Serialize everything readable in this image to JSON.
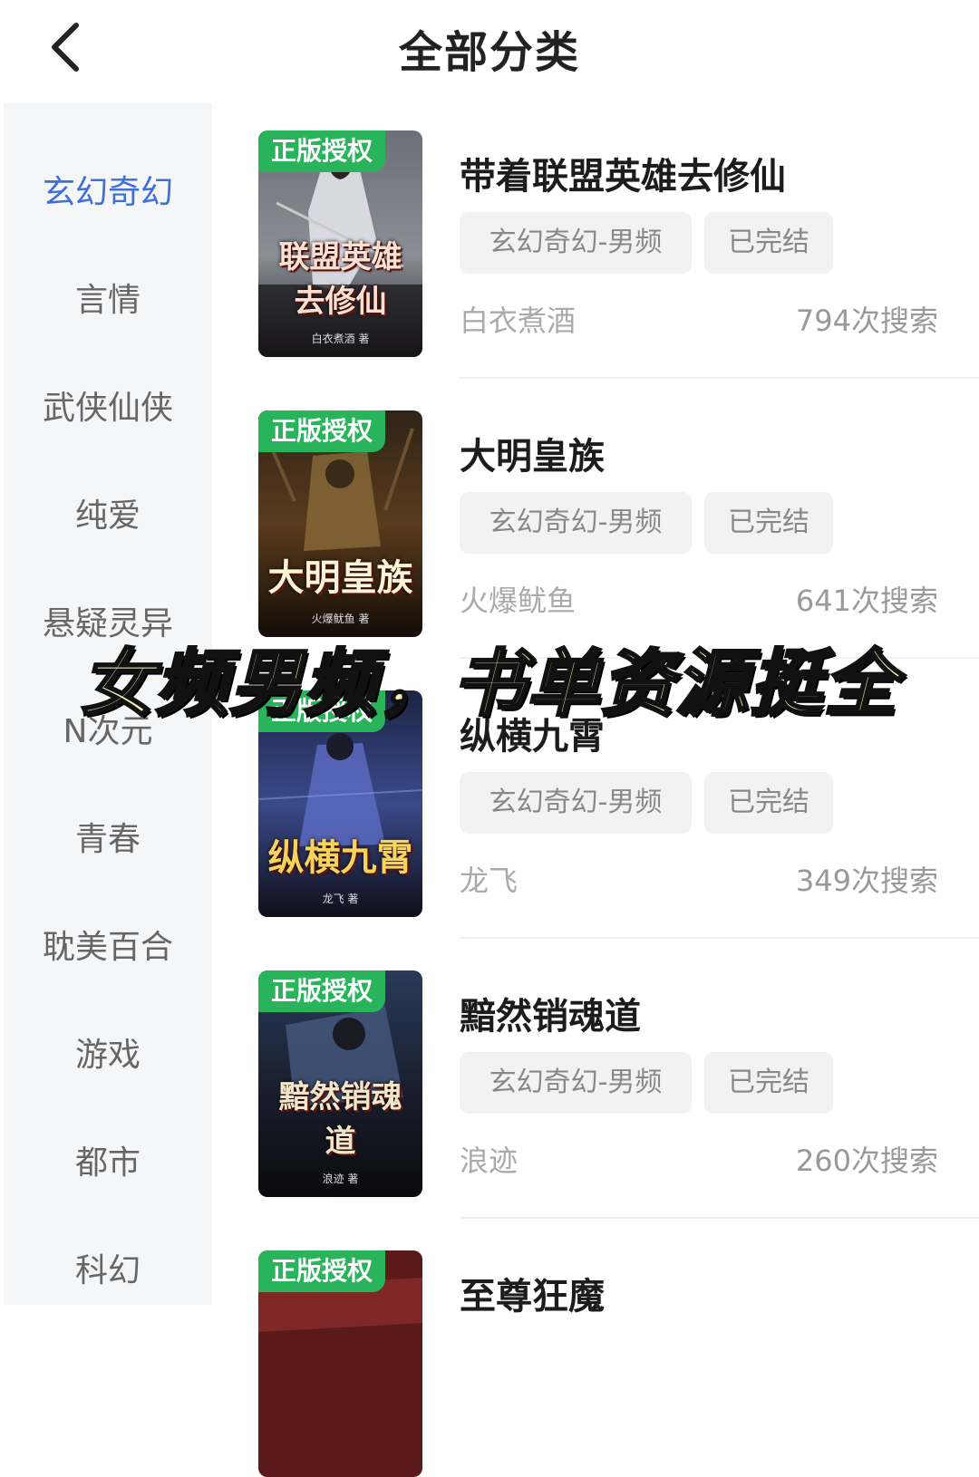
{
  "header": {
    "title": "全部分类",
    "back_icon": "chevron-left-icon"
  },
  "sidebar": {
    "active_index": 0,
    "active_color": "#3f6fd8",
    "items": [
      {
        "label": "玄幻奇幻"
      },
      {
        "label": "言情"
      },
      {
        "label": "武侠仙侠"
      },
      {
        "label": "纯爱"
      },
      {
        "label": "悬疑灵异"
      },
      {
        "label": "N次元"
      },
      {
        "label": "青春"
      },
      {
        "label": "耽美百合"
      },
      {
        "label": "游戏"
      },
      {
        "label": "都市"
      },
      {
        "label": "科幻"
      }
    ]
  },
  "books": [
    {
      "badge": "正版授权",
      "cover_title": "联盟英雄去修仙",
      "cover_author": "白衣煮酒 著",
      "title": "带着联盟英雄去修仙",
      "genre": "玄幻奇幻-男频",
      "status": "已完结",
      "author": "白衣煮酒",
      "searches": "794次搜索"
    },
    {
      "badge": "正版授权",
      "cover_title": "大明皇族",
      "cover_author": "火爆鱿鱼 著",
      "title": "大明皇族",
      "genre": "玄幻奇幻-男频",
      "status": "已完结",
      "author": "火爆鱿鱼",
      "searches": "641次搜索"
    },
    {
      "badge": "正版授权",
      "cover_title": "纵横九霄",
      "cover_author": "龙飞 著",
      "title": "纵横九霄",
      "genre": "玄幻奇幻-男频",
      "status": "已完结",
      "author": "龙飞",
      "searches": "349次搜索"
    },
    {
      "badge": "正版授权",
      "cover_title": "黯然销魂道",
      "cover_author": "浪迹 著",
      "title": "黯然销魂道",
      "genre": "玄幻奇幻-男频",
      "status": "已完结",
      "author": "浪迹",
      "searches": "260次搜索"
    },
    {
      "badge": "正版授权",
      "cover_title": "",
      "cover_author": "",
      "title": "至尊狂魔",
      "genre": "",
      "status": "",
      "author": "",
      "searches": ""
    }
  ],
  "overlay_caption": "女频男频，书单资源挺全",
  "colors": {
    "badge": "#29b45c",
    "sidebar_bg": "#f5f6f8",
    "tag_bg": "#f2f2f2"
  }
}
